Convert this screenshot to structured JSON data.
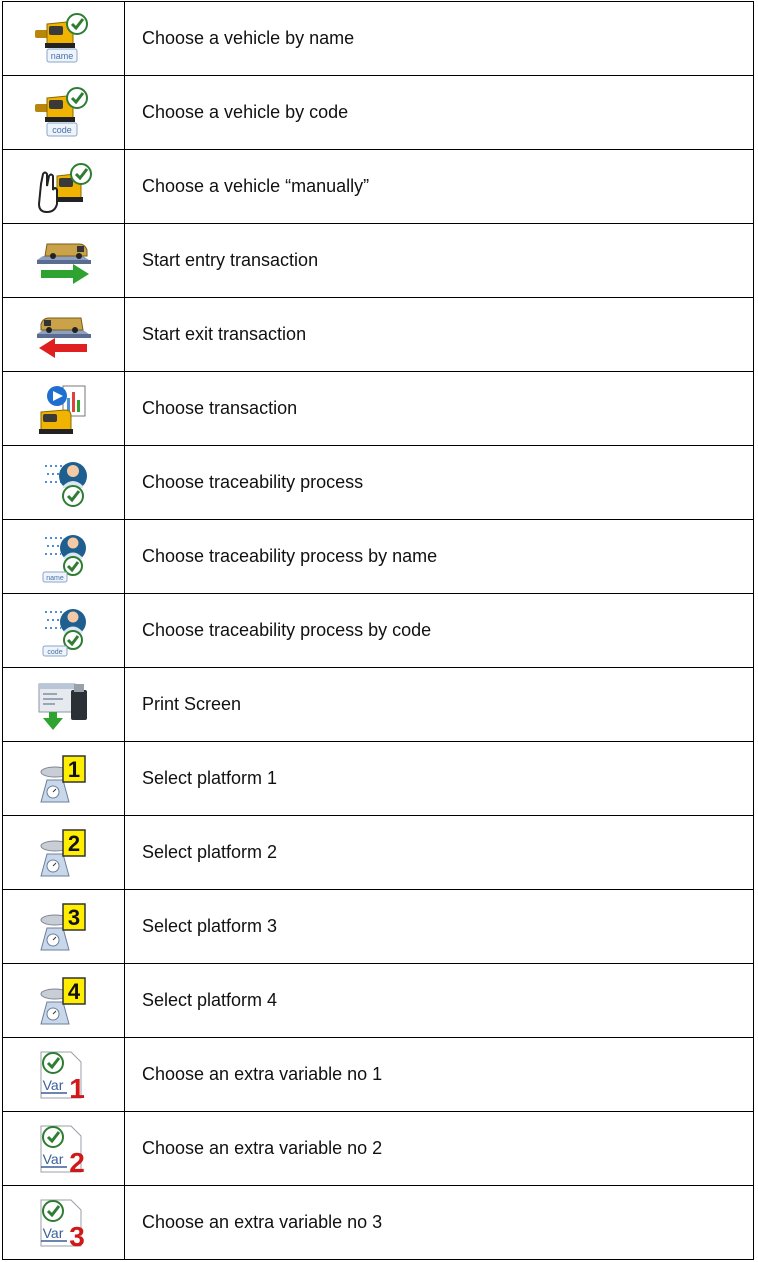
{
  "table": {
    "rows": [
      {
        "icon": "truck-name-icon",
        "icon_tag": "name",
        "label": "Choose a vehicle by name"
      },
      {
        "icon": "truck-code-icon",
        "icon_tag": "code",
        "label": "Choose a vehicle by code"
      },
      {
        "icon": "truck-hand-icon",
        "label": "Choose a vehicle “manually”"
      },
      {
        "icon": "van-entry-arrow-icon",
        "label": "Start entry transaction"
      },
      {
        "icon": "van-exit-arrow-icon",
        "label": "Start exit transaction"
      },
      {
        "icon": "transaction-list-icon",
        "label": "Choose transaction"
      },
      {
        "icon": "traceability-person-icon",
        "label": "Choose traceability process"
      },
      {
        "icon": "traceability-name-icon",
        "icon_tag": "name",
        "label": "Choose traceability process by name"
      },
      {
        "icon": "traceability-code-icon",
        "icon_tag": "code",
        "label": "Choose traceability process by code"
      },
      {
        "icon": "print-screen-usb-icon",
        "label": "Print Screen"
      },
      {
        "icon": "platform-scale-icon",
        "icon_number": "1",
        "label": "Select platform 1"
      },
      {
        "icon": "platform-scale-icon",
        "icon_number": "2",
        "label": "Select platform 2"
      },
      {
        "icon": "platform-scale-icon",
        "icon_number": "3",
        "label": "Select platform 3"
      },
      {
        "icon": "platform-scale-icon",
        "icon_number": "4",
        "label": "Select platform 4"
      },
      {
        "icon": "extra-variable-icon",
        "icon_tag": "Var",
        "icon_number": "1",
        "label": "Choose an extra variable no 1"
      },
      {
        "icon": "extra-variable-icon",
        "icon_tag": "Var",
        "icon_number": "2",
        "label": "Choose an extra variable no 2"
      },
      {
        "icon": "extra-variable-icon",
        "icon_tag": "Var",
        "icon_number": "3",
        "label": "Choose an extra variable no 3"
      }
    ]
  }
}
